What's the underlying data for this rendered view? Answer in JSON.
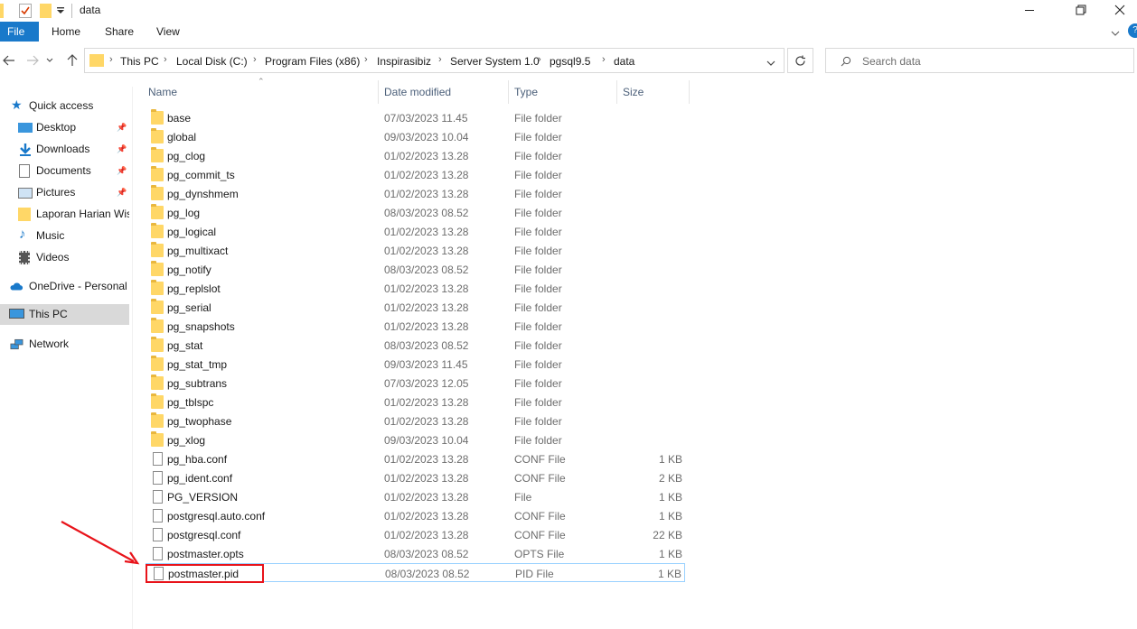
{
  "window": {
    "title": "data",
    "controls": {
      "minimize": "—",
      "restore": "❐",
      "close": "✕"
    }
  },
  "ribbon": {
    "tabs": [
      "File",
      "Home",
      "Share",
      "View"
    ]
  },
  "address": {
    "crumbs": [
      "This PC",
      "Local Disk (C:)",
      "Program Files (x86)",
      "Inspirasibiz",
      "Server System 1.0",
      "pgsql9.5",
      "data"
    ],
    "search_placeholder": "Search data"
  },
  "sidebar": {
    "items": [
      {
        "label": "Quick access",
        "icon": "star-icon",
        "pinned": false
      },
      {
        "label": "Desktop",
        "icon": "desktop-icon",
        "pinned": true
      },
      {
        "label": "Downloads",
        "icon": "download-icon",
        "pinned": true
      },
      {
        "label": "Documents",
        "icon": "document-icon",
        "pinned": true
      },
      {
        "label": "Pictures",
        "icon": "picture-icon",
        "pinned": true
      },
      {
        "label": "Laporan Harian Wis",
        "icon": "folder-icon",
        "pinned": false
      },
      {
        "label": "Music",
        "icon": "music-icon",
        "pinned": false
      },
      {
        "label": "Videos",
        "icon": "video-icon",
        "pinned": false
      },
      {
        "label": "OneDrive - Personal",
        "icon": "cloud-icon",
        "pinned": false
      },
      {
        "label": "This PC",
        "icon": "computer-icon",
        "pinned": false
      },
      {
        "label": "Network",
        "icon": "network-icon",
        "pinned": false
      }
    ]
  },
  "columns": {
    "name": "Name",
    "date": "Date modified",
    "type": "Type",
    "size": "Size"
  },
  "files": [
    {
      "name": "base",
      "date": "07/03/2023 11.45",
      "type": "File folder",
      "size": "",
      "kind": "folder"
    },
    {
      "name": "global",
      "date": "09/03/2023 10.04",
      "type": "File folder",
      "size": "",
      "kind": "folder"
    },
    {
      "name": "pg_clog",
      "date": "01/02/2023 13.28",
      "type": "File folder",
      "size": "",
      "kind": "folder"
    },
    {
      "name": "pg_commit_ts",
      "date": "01/02/2023 13.28",
      "type": "File folder",
      "size": "",
      "kind": "folder"
    },
    {
      "name": "pg_dynshmem",
      "date": "01/02/2023 13.28",
      "type": "File folder",
      "size": "",
      "kind": "folder"
    },
    {
      "name": "pg_log",
      "date": "08/03/2023 08.52",
      "type": "File folder",
      "size": "",
      "kind": "folder"
    },
    {
      "name": "pg_logical",
      "date": "01/02/2023 13.28",
      "type": "File folder",
      "size": "",
      "kind": "folder"
    },
    {
      "name": "pg_multixact",
      "date": "01/02/2023 13.28",
      "type": "File folder",
      "size": "",
      "kind": "folder"
    },
    {
      "name": "pg_notify",
      "date": "08/03/2023 08.52",
      "type": "File folder",
      "size": "",
      "kind": "folder"
    },
    {
      "name": "pg_replslot",
      "date": "01/02/2023 13.28",
      "type": "File folder",
      "size": "",
      "kind": "folder"
    },
    {
      "name": "pg_serial",
      "date": "01/02/2023 13.28",
      "type": "File folder",
      "size": "",
      "kind": "folder"
    },
    {
      "name": "pg_snapshots",
      "date": "01/02/2023 13.28",
      "type": "File folder",
      "size": "",
      "kind": "folder"
    },
    {
      "name": "pg_stat",
      "date": "08/03/2023 08.52",
      "type": "File folder",
      "size": "",
      "kind": "folder"
    },
    {
      "name": "pg_stat_tmp",
      "date": "09/03/2023 11.45",
      "type": "File folder",
      "size": "",
      "kind": "folder"
    },
    {
      "name": "pg_subtrans",
      "date": "07/03/2023 12.05",
      "type": "File folder",
      "size": "",
      "kind": "folder"
    },
    {
      "name": "pg_tblspc",
      "date": "01/02/2023 13.28",
      "type": "File folder",
      "size": "",
      "kind": "folder"
    },
    {
      "name": "pg_twophase",
      "date": "01/02/2023 13.28",
      "type": "File folder",
      "size": "",
      "kind": "folder"
    },
    {
      "name": "pg_xlog",
      "date": "09/03/2023 10.04",
      "type": "File folder",
      "size": "",
      "kind": "folder"
    },
    {
      "name": "pg_hba.conf",
      "date": "01/02/2023 13.28",
      "type": "CONF File",
      "size": "1 KB",
      "kind": "file"
    },
    {
      "name": "pg_ident.conf",
      "date": "01/02/2023 13.28",
      "type": "CONF File",
      "size": "2 KB",
      "kind": "file"
    },
    {
      "name": "PG_VERSION",
      "date": "01/02/2023 13.28",
      "type": "File",
      "size": "1 KB",
      "kind": "file"
    },
    {
      "name": "postgresql.auto.conf",
      "date": "01/02/2023 13.28",
      "type": "CONF File",
      "size": "1 KB",
      "kind": "file"
    },
    {
      "name": "postgresql.conf",
      "date": "01/02/2023 13.28",
      "type": "CONF File",
      "size": "22 KB",
      "kind": "file"
    },
    {
      "name": "postmaster.opts",
      "date": "08/03/2023 08.52",
      "type": "OPTS File",
      "size": "1 KB",
      "kind": "file"
    },
    {
      "name": "postmaster.pid",
      "date": "08/03/2023 08.52",
      "type": "PID File",
      "size": "1 KB",
      "kind": "file",
      "highlighted": true
    }
  ],
  "colors": {
    "accent": "#1979ca",
    "folder": "#ffd767",
    "annotation": "#e8131a",
    "selected_bg": "#d9d9d9"
  }
}
